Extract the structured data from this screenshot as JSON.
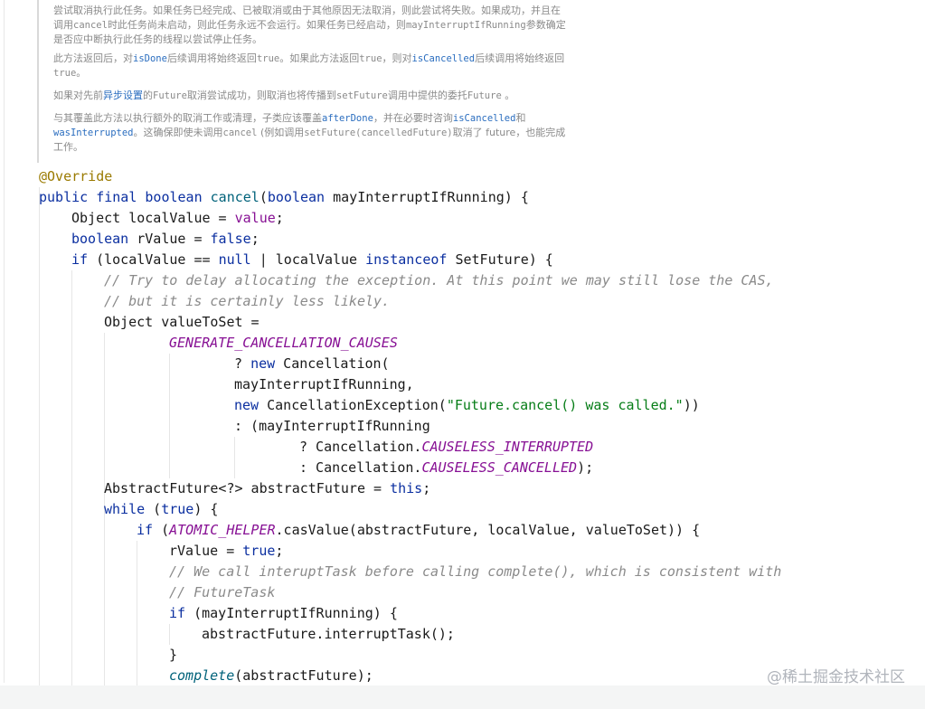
{
  "javadoc": {
    "p1": {
      "line1": "尝试取消执行此任务。如果任务已经完成、已被取消或由于其他原因无法取消，则此尝试将失败。如果成功，并且在",
      "line2a": "调用",
      "line2_code": "cancel",
      "line2b": "时此任务尚未启动，则此任务永远不会运行。如果任务已经启动，则",
      "line2_code2": "mayInterruptIfRunning",
      "line2c": "参数确定",
      "line3": "是否应中断执行此任务的线程以尝试停止任务。"
    },
    "p2": {
      "a": "此方法返回后，对",
      "link1": "isDone",
      "b": "后续调用将始终返回",
      "code1": "true",
      "c": "。如果此方法返回",
      "code2": "true",
      "d": "，则对",
      "link2": "isCancelled",
      "e": "后续调用将始终返回",
      "code3": "true",
      "f": "。"
    },
    "p3": {
      "a": "如果对先前",
      "link1": "异步设置",
      "b": "的",
      "code1": "Future",
      "c": "取消尝试成功，则取消也将传播到",
      "code2": "setFuture",
      "d": "调用中提供的委托",
      "code3": "Future",
      "e": " 。"
    },
    "p4": {
      "a": "与其覆盖此方法以执行额外的取消工作或清理，子类应该覆盖",
      "link1": "afterDone",
      "b": "，并在必要时咨询",
      "link2": "isCancelled",
      "c": "和",
      "link3": "wasInterrupted",
      "d": "。这确保即使未调用",
      "code1": "cancel",
      "e": " (例如调用",
      "code2": "setFuture(cancelledFuture)",
      "f": "取消了 future，也能完成",
      "g": "工作。"
    }
  },
  "code": {
    "annotation": "@Override",
    "sig": {
      "kw": "public final boolean ",
      "name": "cancel",
      "params_kw": "boolean",
      "rest": " mayInterruptIfRunning) {"
    },
    "l3": {
      "a": "Object localValue = ",
      "b": "value",
      "c": ";"
    },
    "l4": {
      "a": "boolean",
      "b": " rValue = ",
      "c": "false",
      "d": ";"
    },
    "l5": {
      "a": "if",
      "b": " (localValue == ",
      "c": "null",
      "d": " | localValue ",
      "e": "instanceof",
      "f": " SetFuture) {"
    },
    "l6": "// Try to delay allocating the exception. At this point we may still lose the CAS,",
    "l7": "// but it is certainly less likely.",
    "l8": "Object valueToSet =",
    "l9": "GENERATE_CANCELLATION_CAUSES",
    "l10": {
      "a": "? ",
      "b": "new",
      "c": " Cancellation("
    },
    "l11": "mayInterruptIfRunning,",
    "l12": {
      "a": "new",
      "b": " CancellationException(",
      "c": "\"Future.cancel() was called.\"",
      "d": "))"
    },
    "l13": ": (mayInterruptIfRunning",
    "l14": {
      "a": "? Cancellation.",
      "b": "CAUSELESS_INTERRUPTED"
    },
    "l15": {
      "a": ": Cancellation.",
      "b": "CAUSELESS_CANCELLED",
      "c": ");"
    },
    "l16": {
      "a": "AbstractFuture<?> abstractFuture = ",
      "b": "this",
      "c": ";"
    },
    "l17": {
      "a": "while",
      "b": " (",
      "c": "true",
      "d": ") {"
    },
    "l18": {
      "a": "if",
      "b": " (",
      "c": "ATOMIC_HELPER",
      "d": ".casValue(abstractFuture, localValue, valueToSet)) {"
    },
    "l19": {
      "a": "rValue = ",
      "b": "true",
      "c": ";"
    },
    "l20": "// We call interuptTask before calling complete(), which is consistent with",
    "l21": "// FutureTask",
    "l22": {
      "a": "if",
      "b": " (mayInterruptIfRunning) {"
    },
    "l23": "abstractFuture.interruptTask();",
    "l24": "}",
    "l25": {
      "a": "complete",
      "b": "(abstractFuture);"
    }
  },
  "watermark": "@稀土掘金技术社区"
}
